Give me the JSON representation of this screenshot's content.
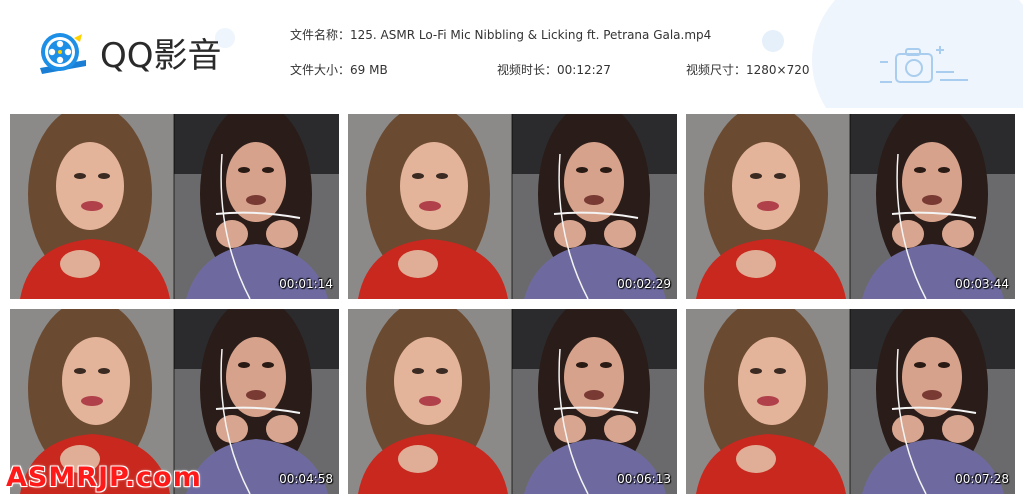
{
  "app": {
    "logo_text": "QQ影音",
    "logo_icon": "film-reel-icon"
  },
  "file_info": {
    "name_label": "文件名称：",
    "name_value": "125. ASMR Lo-Fi Mic Nibbling & Licking ft. Petrana Gala.mp4",
    "size_label": "文件大小：",
    "size_value": "69 MB",
    "duration_label": "视频时长：",
    "duration_value": "00:12:27",
    "dimension_label": "视频尺寸：",
    "dimension_value": "1280×720"
  },
  "thumbnails": [
    {
      "timestamp": "00:01:14"
    },
    {
      "timestamp": "00:02:29"
    },
    {
      "timestamp": "00:03:44"
    },
    {
      "timestamp": "00:04:58"
    },
    {
      "timestamp": "00:06:13"
    },
    {
      "timestamp": "00:07:28"
    }
  ],
  "watermark": {
    "text": "ASMRJP.com"
  },
  "colors": {
    "accent_blue": "#1e8fe6",
    "watermark_red": "#ff1a1a",
    "deco_blue": "#eef5fc"
  }
}
